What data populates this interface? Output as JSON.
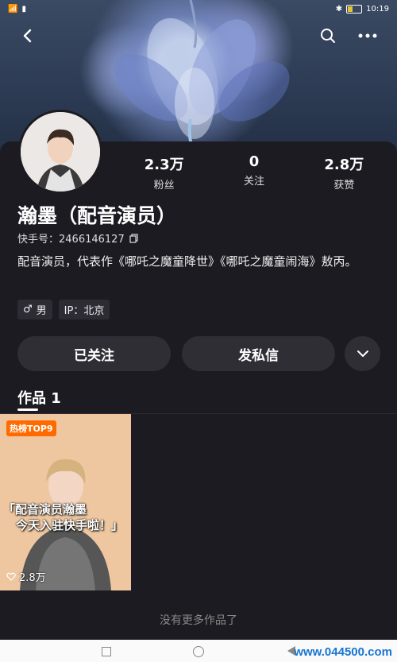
{
  "status_bar": {
    "time": "10:19",
    "battery_icon": "battery-icon",
    "wifi_icon": "wifi-icon",
    "bluetooth_icon": "bluetooth-icon"
  },
  "top_bar": {
    "back_icon": "chevron-left-icon",
    "search_icon": "search-icon",
    "more_icon": "more-icon"
  },
  "profile": {
    "name": "瀚墨（配音演员）",
    "uid_label": "快手号：2466146127",
    "bio": "配音演员，代表作《哪吒之魔童降世》《哪吒之魔童闹海》敖丙。",
    "tags": [
      {
        "icon": "male-icon",
        "label": "男"
      },
      {
        "icon": "",
        "label": "IP：北京"
      }
    ]
  },
  "stats": [
    {
      "value": "2.3万",
      "label": "粉丝"
    },
    {
      "value": "0",
      "label": "关注"
    },
    {
      "value": "2.8万",
      "label": "获赞"
    }
  ],
  "actions": {
    "follow_label": "已关注",
    "message_label": "发私信",
    "dropdown_icon": "chevron-down-icon"
  },
  "tabs": [
    {
      "label": "作品 1",
      "active": true
    }
  ],
  "works": [
    {
      "badge": "热榜TOP9",
      "caption_line1": "「配音演员瀚墨",
      "caption_line2": "今天入驻快手啦！」",
      "likes": "2.8万"
    }
  ],
  "footer_text": "没有更多作品了",
  "watermark": "www.044500.com",
  "colors": {
    "background": "#1c1b22",
    "button": "#2f2e35",
    "badge": "#ff6a00",
    "watermark": "#1676d2"
  }
}
